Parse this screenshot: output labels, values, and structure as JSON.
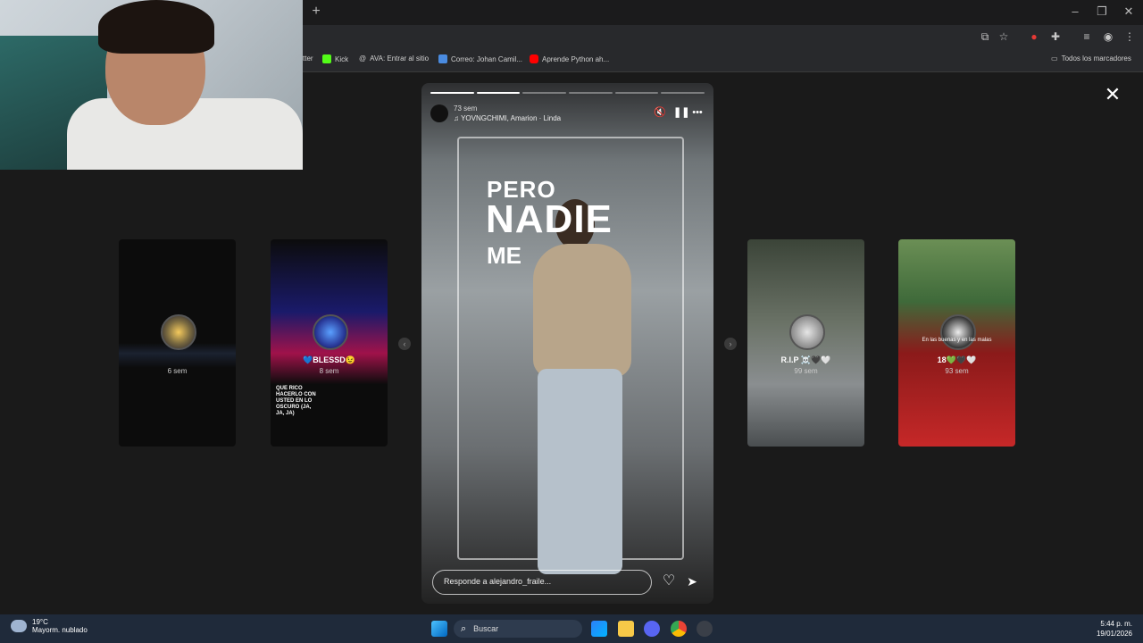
{
  "browser": {
    "new_tab": "+",
    "window_controls": [
      "–",
      "❐",
      "✕"
    ],
    "bookmarks": [
      {
        "label": "tter",
        "icon": "bookmark-icon"
      },
      {
        "label": "Kick",
        "icon": "kick-icon",
        "color": "#53fc18"
      },
      {
        "label": "AVA: Entrar al sitio",
        "icon": "at-icon"
      },
      {
        "label": "Correo: Johan Camil...",
        "icon": "mail-icon",
        "color": "#4a8be0"
      },
      {
        "label": "Aprende Python ah...",
        "icon": "youtube-icon",
        "color": "#ff0000"
      }
    ],
    "all_bookmarks": "Todos los marcadores"
  },
  "viewer": {
    "close": "✕",
    "left_cards": [
      {
        "name": "",
        "time": "6 sem"
      },
      {
        "name": "💙BLESSD😉",
        "time": "8 sem",
        "caption": "QUE RICO HACERLO CON USTED EN LO OSCURO (JA, JA, JA)"
      }
    ],
    "right_cards": [
      {
        "name": "R.I.P ☠️🖤🤍",
        "time": "99 sem"
      },
      {
        "name": "18💚🖤🤍",
        "time": "93 sem",
        "caption": "En las buenas y en las malas"
      }
    ],
    "main_story": {
      "time": "73 sem",
      "song": "YOVNGCHIMI, Amarion · Linda",
      "text_lines": [
        "PERO",
        "NADIE",
        "ME"
      ],
      "reply_placeholder": "Responde a alejandro_fraile...",
      "progress_segments": [
        1,
        1,
        0,
        0,
        0,
        0
      ]
    }
  },
  "taskbar": {
    "temperature": "19°C",
    "weather": "Mayorm. nublado",
    "search_label": "Buscar",
    "time": "5:44 p. m.",
    "date": "19/01/2026"
  },
  "colors": {
    "accent": "#ffffff",
    "taskbar": "#1f2a3a"
  }
}
